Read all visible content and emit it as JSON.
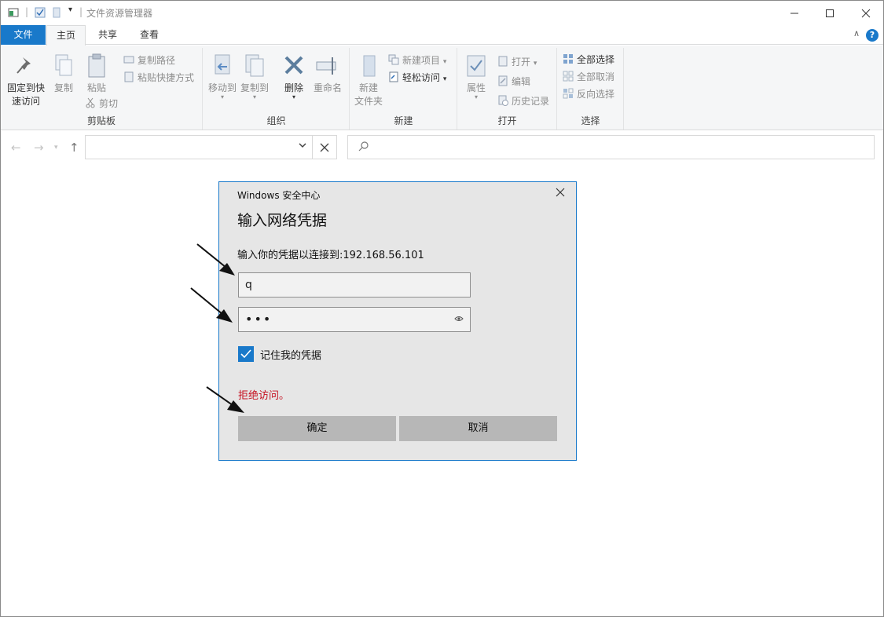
{
  "window": {
    "title": "文件资源管理器"
  },
  "ribbon_tabs": [
    {
      "label": "文件"
    },
    {
      "label": "主页"
    },
    {
      "label": "共享"
    },
    {
      "label": "查看"
    }
  ],
  "ribbon": {
    "clipboard": {
      "label": "剪贴板",
      "pin": "固定到快\n速访问",
      "pin_line1": "固定到快",
      "pin_line2": "速访问",
      "copy": "复制",
      "paste": "粘贴",
      "copy_path": "复制路径",
      "paste_shortcut": "粘贴快捷方式",
      "cut": "剪切"
    },
    "organize": {
      "label": "组织",
      "move_to": "移动到",
      "copy_to": "复制到",
      "delete": "删除",
      "rename": "重命名"
    },
    "new": {
      "label": "新建",
      "new_folder_line1": "新建",
      "new_folder_line2": "文件夹",
      "new_item": "新建项目",
      "easy_access": "轻松访问"
    },
    "open": {
      "label": "打开",
      "properties": "属性",
      "open": "打开",
      "edit": "编辑",
      "history": "历史记录"
    },
    "select": {
      "label": "选择",
      "select_all": "全部选择",
      "select_none": "全部取消",
      "invert": "反向选择"
    }
  },
  "address": {
    "value": ""
  },
  "search": {
    "placeholder": ""
  },
  "dialog": {
    "app_name": "Windows 安全中心",
    "title": "输入网络凭据",
    "description": "输入你的凭据以连接到:192.168.56.101",
    "username_value": "q",
    "password_value": "•••",
    "remember_label": "记住我的凭据",
    "remember_checked": true,
    "error": "拒绝访问。",
    "ok_label": "确定",
    "cancel_label": "取消"
  },
  "colors": {
    "accent": "#1979ca",
    "error": "#c50f1f",
    "dialog_bg": "#e6e6e6",
    "ribbon_bg": "#f5f6f7"
  }
}
